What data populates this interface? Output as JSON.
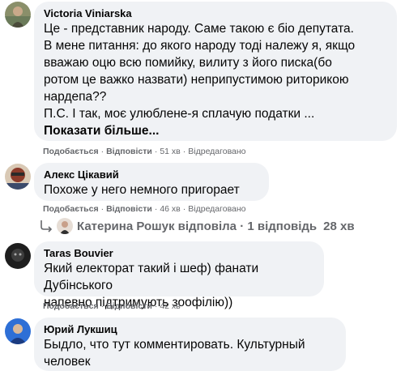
{
  "comments": [
    {
      "author": "Victoria Viniarska",
      "text": "Це - представник народу. Саме такою є біо депутата.\nВ мене питання: до якого народу тоді належу я, якщо\nвважаю оцю всю помийку, вилиту з його писка(бо\nротом це важко назвати) неприпустимою риторикою\nнардепа??\nП.С. І так, моє улюблене-я сплачую податки ...",
      "more_label": "Показати більше...",
      "like_label": "Подобається",
      "reply_label": "Відповісти",
      "time": "51 хв",
      "edited": "Відредаговано"
    },
    {
      "author": "Алекс Цікавий",
      "text": "Похоже у него немного пригорает",
      "like_label": "Подобається",
      "reply_label": "Відповісти",
      "time": "46 хв",
      "edited": "Відредаговано"
    },
    {
      "author": "Taras Bouvier",
      "text": "Який електорат такий і шеф) фанати Дубінського\nнапевно підтримують зоофілію))",
      "like_label": "Подобається",
      "reply_label": "Відповісти",
      "time": "42 хв"
    },
    {
      "author": "Юрий Лукшиц",
      "text": "Быдло, что тут комментировать. Культурный человек\nне будет подобные выражения говорить."
    }
  ],
  "reply_thread": {
    "text": "Катерина Рошук відповіла · 1 відповідь",
    "time": "28 хв"
  },
  "colors": {
    "bubble": "#f0f2f5",
    "secondary_text": "#65676b",
    "primary_text": "#050505"
  }
}
